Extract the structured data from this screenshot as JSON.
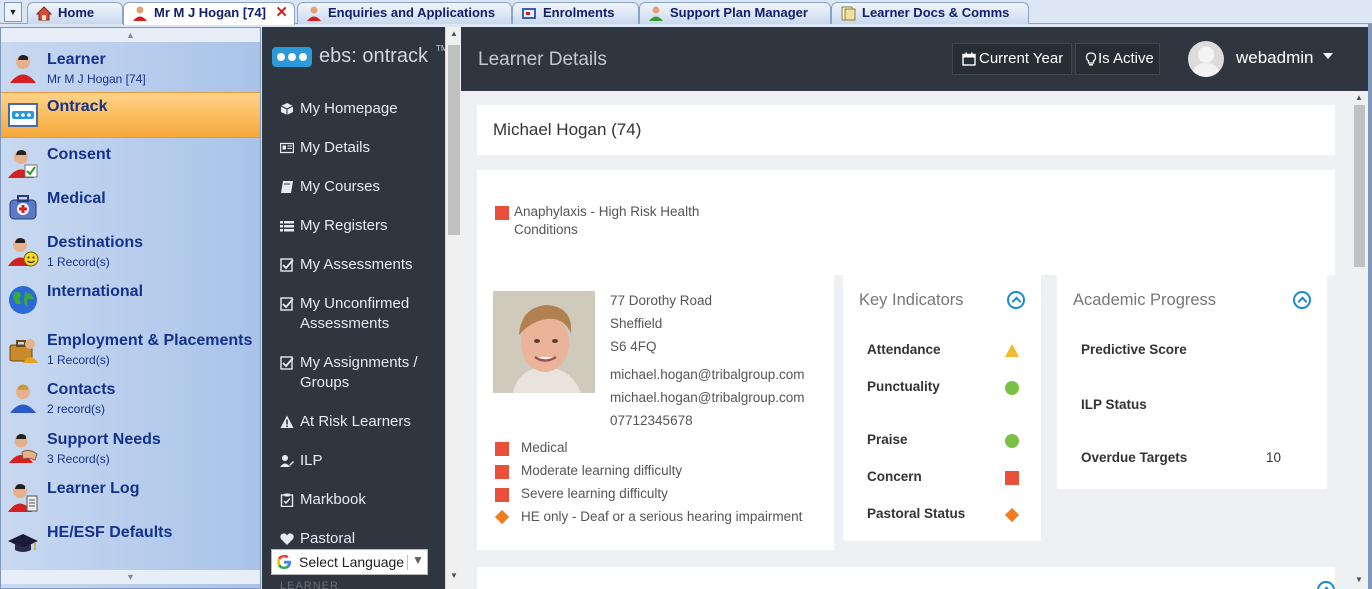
{
  "tabs": [
    {
      "label": "Home",
      "icon": "home-icon"
    },
    {
      "label": "Mr M J Hogan [74]",
      "icon": "learner-icon",
      "active": true,
      "close": "✕"
    },
    {
      "label": "Enquiries and Applications",
      "icon": "enquiries-icon"
    },
    {
      "label": "Enrolments",
      "icon": "enrolments-icon"
    },
    {
      "label": "Support Plan Manager",
      "icon": "support-plan-icon"
    },
    {
      "label": "Learner Docs & Comms",
      "icon": "docs-comms-icon"
    }
  ],
  "tab_menu_glyph": "▼",
  "left_nav": {
    "up_arrow": "▲",
    "down_arrow": "▼",
    "items": [
      {
        "label": "Learner",
        "sub": "Mr M J Hogan [74]",
        "icon": "learner-icon"
      },
      {
        "label": "Ontrack",
        "sub": "",
        "icon": "ontrack-icon",
        "selected": true
      },
      {
        "label": "Consent",
        "sub": "",
        "icon": "consent-icon"
      },
      {
        "label": "Medical",
        "sub": "",
        "icon": "medical-kit-icon"
      },
      {
        "label": "Destinations",
        "sub": "1 Record(s)",
        "icon": "destinations-icon"
      },
      {
        "label": "International",
        "sub": "",
        "icon": "globe-icon"
      },
      {
        "label": "Employment & Placements",
        "sub": "1 Record(s)",
        "icon": "employment-icon"
      },
      {
        "label": "Contacts",
        "sub": "2 record(s)",
        "icon": "contacts-icon"
      },
      {
        "label": "Support Needs",
        "sub": "3 Record(s)",
        "icon": "support-needs-icon"
      },
      {
        "label": "Learner Log",
        "sub": "",
        "icon": "learner-log-icon"
      },
      {
        "label": "HE/ESF Defaults",
        "sub": "",
        "icon": "graduation-cap-icon"
      }
    ]
  },
  "sidebar": {
    "logo_text": "ebs: ontrack",
    "logo_tm": "TM",
    "items": [
      {
        "label": "My Homepage",
        "icon": "cube-icon"
      },
      {
        "label": "My Details",
        "icon": "id-card-icon"
      },
      {
        "label": "My Courses",
        "icon": "book-icon"
      },
      {
        "label": "My Registers",
        "icon": "list-icon"
      },
      {
        "label": "My Assessments",
        "icon": "checklist-icon"
      },
      {
        "label": "My Unconfirmed Assessments",
        "icon": "checklist-icon"
      },
      {
        "label": "My Assignments / Groups",
        "icon": "checklist-icon"
      },
      {
        "label": "At Risk Learners",
        "icon": "warning-icon"
      },
      {
        "label": "ILP",
        "icon": "user-edit-icon"
      },
      {
        "label": "Markbook",
        "icon": "clipboard-icon"
      },
      {
        "label": "Pastoral",
        "icon": "heart-icon"
      }
    ],
    "language": {
      "label": "Select Language",
      "arrow": "▼"
    },
    "bottom_text": "LEARNER"
  },
  "topbar": {
    "title": "Learner Details",
    "current_year": "Current Year",
    "is_active": "Is Active",
    "username": "webadmin"
  },
  "learner": {
    "name": "Michael Hogan (74)",
    "alert": "Anaphylaxis - High Risk Health Conditions",
    "address": [
      "77 Dorothy Road",
      "Sheffield",
      "S6 4FQ"
    ],
    "emails": [
      "michael.hogan@tribalgroup.com",
      "michael.hogan@tribalgroup.com"
    ],
    "phone": "07712345678",
    "flags": [
      {
        "label": "Medical",
        "shape": "square"
      },
      {
        "label": "Moderate learning difficulty",
        "shape": "square"
      },
      {
        "label": "Severe learning difficulty",
        "shape": "square"
      },
      {
        "label": "HE only - Deaf or a serious hearing impairment",
        "shape": "diamond"
      }
    ]
  },
  "key_indicators": {
    "title": "Key Indicators",
    "items": [
      {
        "label": "Attendance",
        "status": "amber-triangle"
      },
      {
        "label": "Punctuality",
        "status": "green-circle"
      },
      {
        "label": "Praise",
        "status": "green-circle"
      },
      {
        "label": "Concern",
        "status": "red-square"
      },
      {
        "label": "Pastoral Status",
        "status": "orange-diamond"
      }
    ]
  },
  "academic_progress": {
    "title": "Academic Progress",
    "items": [
      {
        "label": "Predictive Score",
        "value": ""
      },
      {
        "label": "ILP Status",
        "value": ""
      },
      {
        "label": "Overdue Targets",
        "value": "10"
      }
    ]
  },
  "colors": {
    "accent_blue": "#1a8ad0",
    "alert_red": "#e8503a",
    "amber": "#f4b92f",
    "green": "#7ac143",
    "orange": "#f07d1e",
    "sidebar_dark": "#2f3640",
    "nav_selected": "#f6a83a"
  }
}
